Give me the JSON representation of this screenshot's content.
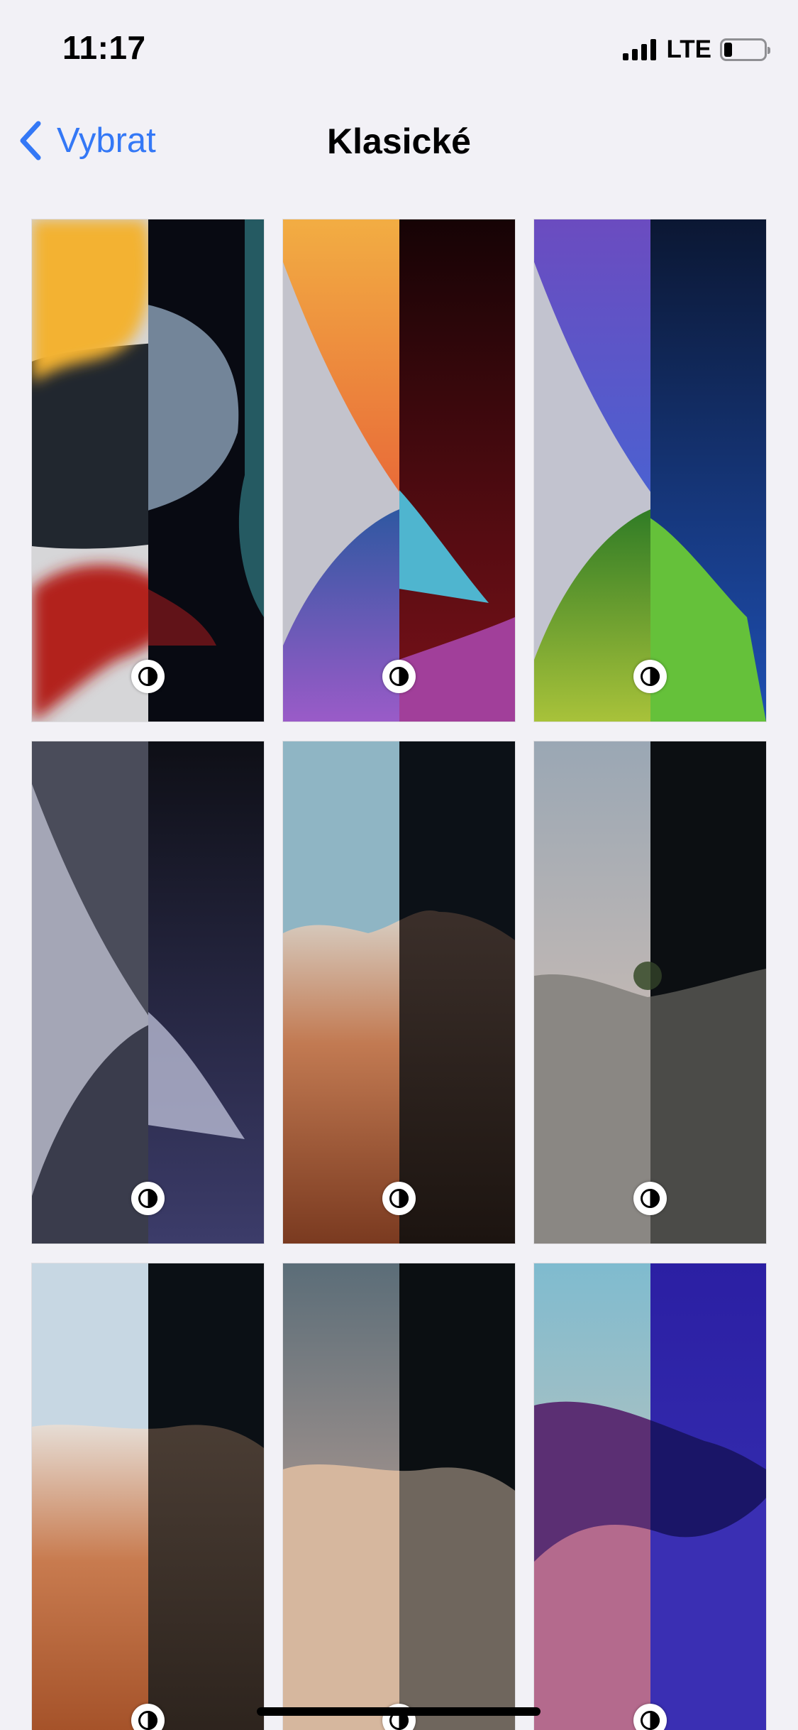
{
  "status_bar": {
    "time": "11:17",
    "network": "LTE",
    "battery_percent": 20
  },
  "nav": {
    "back_label": "Vybrat",
    "title": "Klasické",
    "accent_color": "#3478f6"
  },
  "wallpapers": [
    {
      "icon": "appearance-toggle-icon"
    },
    {
      "icon": "appearance-toggle-icon"
    },
    {
      "icon": "appearance-toggle-icon"
    },
    {
      "icon": "appearance-toggle-icon"
    },
    {
      "icon": "appearance-toggle-icon"
    },
    {
      "icon": "appearance-toggle-icon"
    },
    {
      "icon": "appearance-toggle-icon"
    },
    {
      "icon": "appearance-toggle-icon"
    },
    {
      "icon": "appearance-toggle-icon"
    }
  ]
}
